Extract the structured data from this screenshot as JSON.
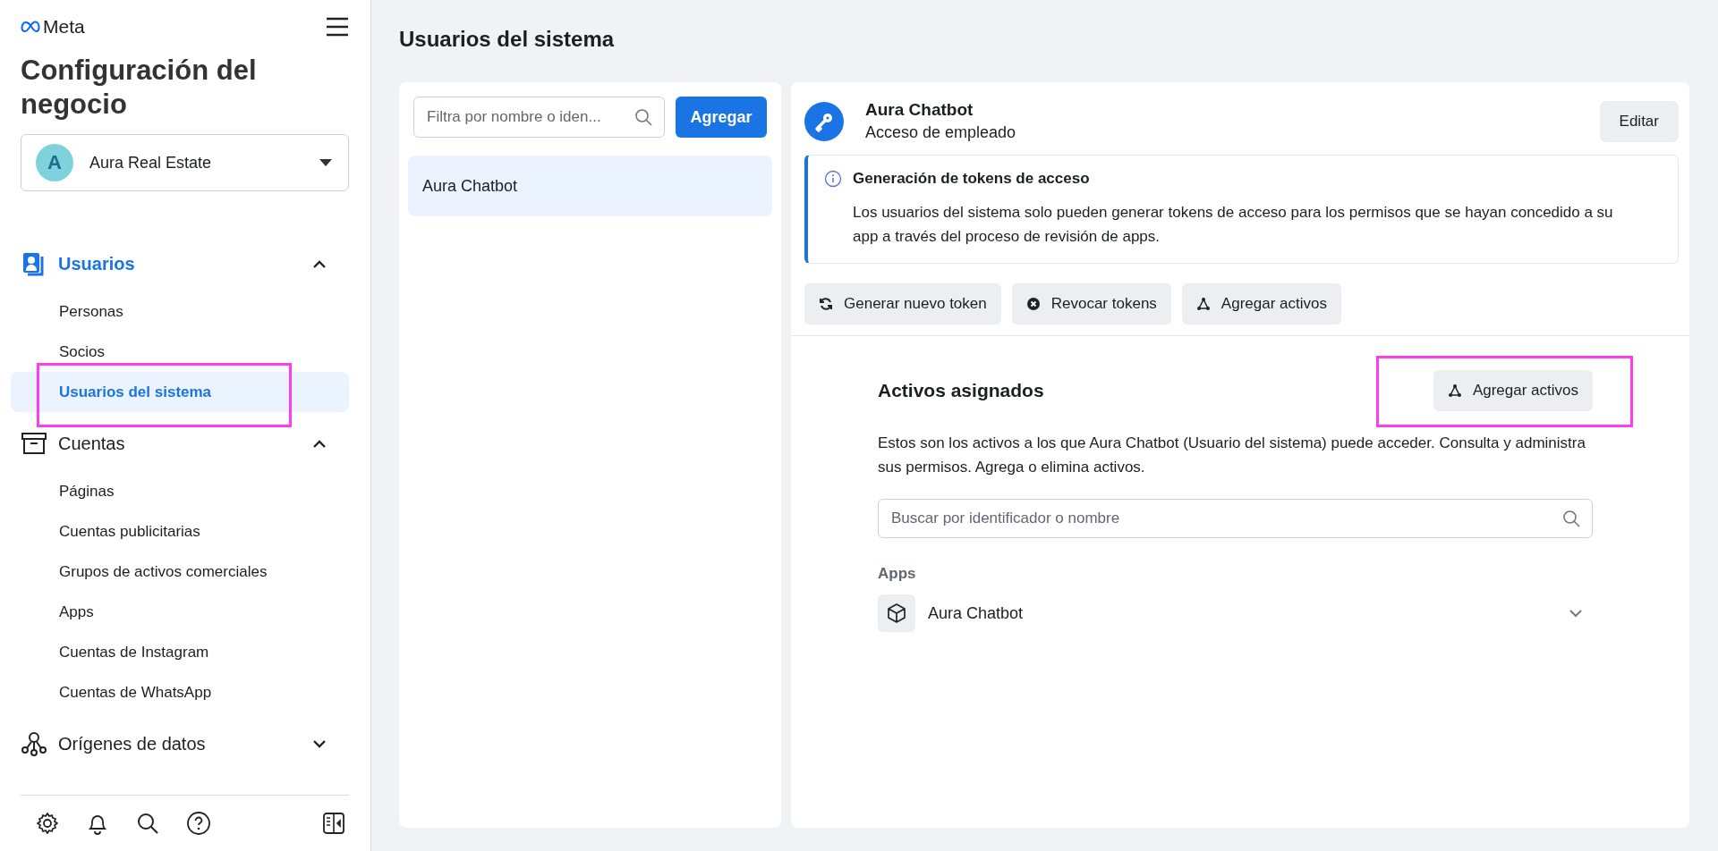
{
  "sidebar": {
    "logo": "Meta",
    "title": "Configuración del negocio",
    "account": {
      "initial": "A",
      "name": "Aura Real Estate"
    },
    "nav": [
      {
        "kind": "users",
        "label": "Usuarios",
        "selected": true,
        "expanded": true,
        "children": [
          {
            "label": "Personas",
            "selected": false
          },
          {
            "label": "Socios",
            "selected": false
          },
          {
            "label": "Usuarios del sistema",
            "selected": true
          }
        ]
      },
      {
        "kind": "accounts",
        "label": "Cuentas",
        "selected": false,
        "expanded": true,
        "children": [
          {
            "label": "Páginas",
            "selected": false
          },
          {
            "label": "Cuentas publicitarias",
            "selected": false
          },
          {
            "label": "Grupos de activos comerciales",
            "selected": false
          },
          {
            "label": "Apps",
            "selected": false
          },
          {
            "label": "Cuentas de Instagram",
            "selected": false
          },
          {
            "label": "Cuentas de WhatsApp",
            "selected": false
          }
        ]
      },
      {
        "kind": "data",
        "label": "Orígenes de datos",
        "selected": false,
        "expanded": false
      }
    ]
  },
  "page_title": "Usuarios del sistema",
  "user_list": {
    "filter": {
      "placeholder": "Filtra por nombre o iden..."
    },
    "add_button": "Agregar",
    "items": [
      {
        "label": "Aura Chatbot",
        "selected": true
      }
    ]
  },
  "detail": {
    "name": "Aura Chatbot",
    "role": "Acceso de empleado",
    "edit_button": "Editar",
    "notice": {
      "title": "Generación de tokens de acceso",
      "text": "Los usuarios del sistema solo pueden generar tokens de acceso para los permisos que se hayan concedido a su app a través del proceso de revisión de apps."
    },
    "actions": [
      {
        "kind": "refresh",
        "label": "Generar nuevo token"
      },
      {
        "kind": "revoke",
        "label": "Revocar tokens"
      },
      {
        "kind": "assets",
        "label": "Agregar activos"
      }
    ],
    "assets": {
      "title": "Activos asignados",
      "add_button": "Agregar activos",
      "description": "Estos son los activos a los que Aura Chatbot (Usuario del sistema) puede acceder. Consulta y administra sus permisos. Agrega o elimina activos.",
      "search": {
        "placeholder": "Buscar por identificador o nombre"
      },
      "groups": [
        {
          "title": "Apps",
          "items": [
            {
              "label": "Aura Chatbot",
              "expanded": false
            }
          ]
        }
      ]
    }
  }
}
